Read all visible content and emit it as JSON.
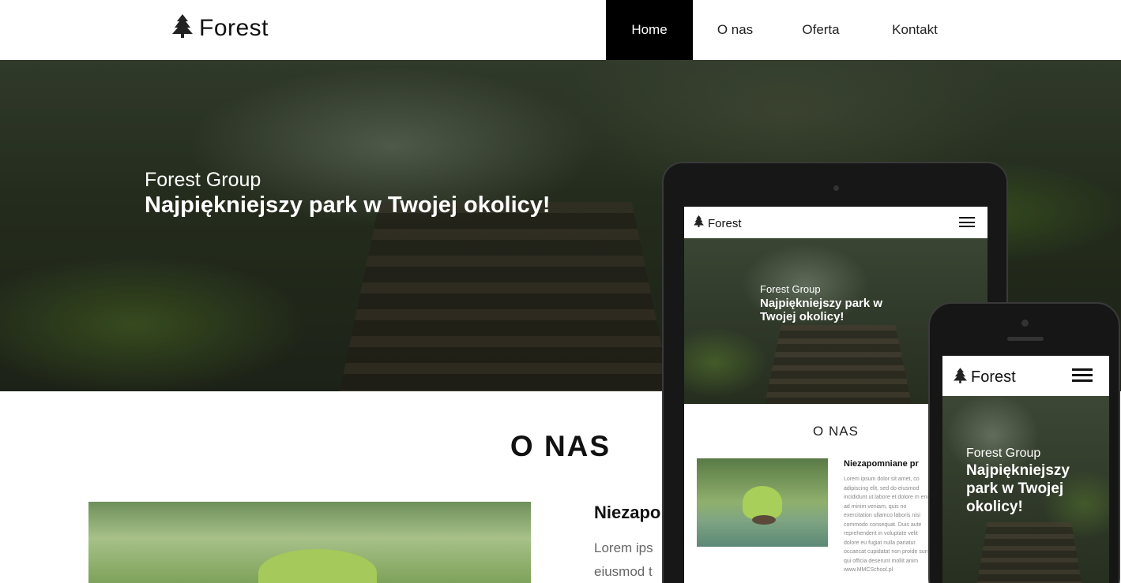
{
  "nav": {
    "brand": "Forest",
    "brand_icon": "tree-icon",
    "items": [
      {
        "label": "Home",
        "active": true
      },
      {
        "label": "O nas",
        "active": false
      },
      {
        "label": "Oferta",
        "active": false
      },
      {
        "label": "Kontakt",
        "active": false
      }
    ]
  },
  "hero": {
    "subtitle": "Forest Group",
    "title": "Najpiękniejszy park w Twojej okolicy!"
  },
  "about": {
    "heading": "O NAS",
    "title": "Niezapo",
    "text_line1": "Lorem ips",
    "text_line2": "eiusmod t"
  },
  "tablet": {
    "brand": "Forest",
    "hero_subtitle": "Forest Group",
    "hero_title": "Najpiękniejszy park w Twojej okolicy!",
    "about_heading": "O NAS",
    "about_title": "Niezapomniane pr",
    "about_text": "Lorem ipsum dolor sit amet, co adipiscing elit, sed do eiusmod incididunt ut labore et dolore m enim ad minim veniam, quis no exercitation ullamco laboris nisi commodo consequat. Duis aute reprehenderit in voluptate velit dolore eu fugiat nulla pariatur. occaecat cupidatat non proide sunt qui officia deserunt mollit anim www.MMCSchool.pl"
  },
  "phone": {
    "brand": "Forest",
    "hero_subtitle": "Forest Group",
    "hero_title": "Najpiękniejszy park w Twojej okolicy!"
  },
  "colors": {
    "nav_active_bg": "#000000",
    "text": "#111111",
    "muted_text": "#666666"
  }
}
